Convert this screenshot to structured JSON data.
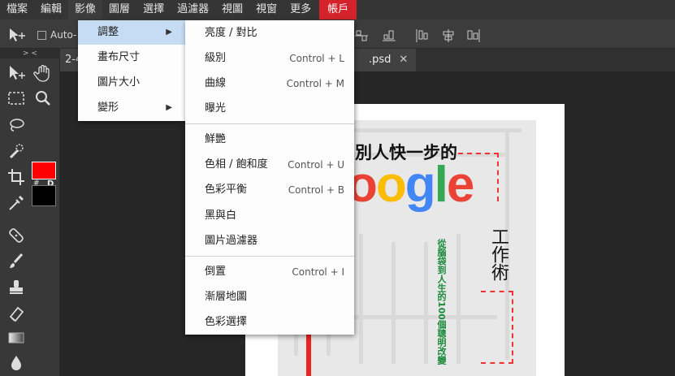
{
  "menubar": {
    "items": [
      "檔案",
      "編輯",
      "影像",
      "圖層",
      "選擇",
      "過濾器",
      "視圖",
      "視窗",
      "更多"
    ],
    "account": "帳戶",
    "account_color": "#d4232b"
  },
  "options_bar": {
    "auto_select_label": "Auto-"
  },
  "panel_grip": "> <",
  "tabs": {
    "left_label": "2-4",
    "right_label": ".psd",
    "close_glyph": "✕"
  },
  "swatches": {
    "foreground": "#ff0000",
    "background": "#000000",
    "swap_label": "#",
    "default_label": "D"
  },
  "image_menu": {
    "items": [
      {
        "label": "調整",
        "has_submenu": true,
        "active": true
      },
      {
        "label": "畫布尺寸",
        "has_submenu": false
      },
      {
        "label": "圖片大小",
        "has_submenu": false
      },
      {
        "label": "變形",
        "has_submenu": true
      }
    ],
    "arrow_glyph": "▶"
  },
  "adjust_submenu": {
    "items": [
      {
        "label": "亮度 / 對比",
        "shortcut": ""
      },
      {
        "label": "級別",
        "shortcut": "Control + L"
      },
      {
        "label": "曲線",
        "shortcut": "Control + M"
      },
      {
        "label": "曝光",
        "shortcut": ""
      },
      {
        "label": "鮮艷",
        "shortcut": ""
      },
      {
        "label": "色相 / 飽和度",
        "shortcut": "Control + U"
      },
      {
        "label": "色彩平衡",
        "shortcut": "Control + B"
      },
      {
        "label": "黑與白",
        "shortcut": ""
      },
      {
        "label": "圖片過濾器",
        "shortcut": ""
      },
      {
        "label": "倒置",
        "shortcut": "Control + I"
      },
      {
        "label": "漸層地圖",
        "shortcut": ""
      },
      {
        "label": "色彩選擇",
        "shortcut": ""
      }
    ]
  },
  "canvas": {
    "title_line": "別人快一步的",
    "logo_letters": [
      "o",
      "o",
      "g",
      "l",
      "e"
    ],
    "logo_colors": [
      "#ea4335",
      "#fbbc05",
      "#4285f4",
      "#34a853",
      "#ea4335"
    ],
    "subtitle_vertical": "工作術",
    "tagline_vertical": "從腦袋到人生的100個聰明改變"
  }
}
